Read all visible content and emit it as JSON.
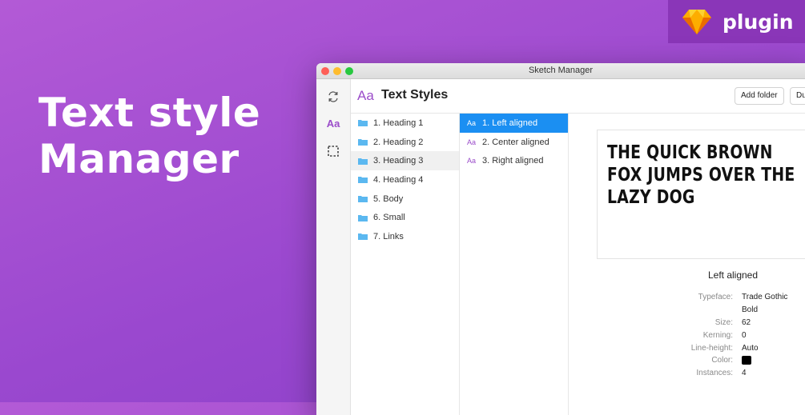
{
  "hero": {
    "title_line1": "Text style",
    "title_line2": "Manager"
  },
  "badge": {
    "label": "plugin",
    "icon": "sketch-diamond-icon"
  },
  "window": {
    "title": "Sketch Manager",
    "header": {
      "icon_text": "Aa",
      "title": "Text Styles",
      "add_folder": "Add folder",
      "duplicate": "Duplicate"
    },
    "rail": {
      "icons": [
        "sync-icon",
        "text-styles-icon",
        "selection-icon"
      ],
      "aa": "Aa"
    },
    "folders": [
      {
        "label": "1. Heading 1"
      },
      {
        "label": "2. Heading 2"
      },
      {
        "label": "3. Heading 3",
        "selected": true
      },
      {
        "label": "4. Heading 4"
      },
      {
        "label": "5. Body"
      },
      {
        "label": "6. Small"
      },
      {
        "label": "7. Links"
      }
    ],
    "styles": [
      {
        "icon": "Aa",
        "label": "1. Left aligned",
        "active": true
      },
      {
        "icon": "Aa",
        "label": "2. Center aligned"
      },
      {
        "icon": "Aa",
        "label": "3. Right aligned"
      }
    ],
    "preview": {
      "line1": "THE QUICK BROWN",
      "line2": "FOX JUMPS OVER THE",
      "line3": "LAZY DOG"
    },
    "details": {
      "title": "Left aligned",
      "labels": {
        "typeface": "Typeface:",
        "size": "Size:",
        "kerning": "Kerning:",
        "line_height": "Line-height:",
        "color": "Color:",
        "instances": "Instances:"
      },
      "values": {
        "typeface_line1": "Trade Gothic",
        "typeface_line2": "Bold",
        "size": "62",
        "kerning": "0",
        "line_height": "Auto",
        "color": "#000000",
        "instances": "4"
      }
    }
  },
  "colors": {
    "accent_purple": "#9b4dca",
    "selection_blue": "#1b8ff2",
    "folder_blue": "#5bb8f0"
  }
}
